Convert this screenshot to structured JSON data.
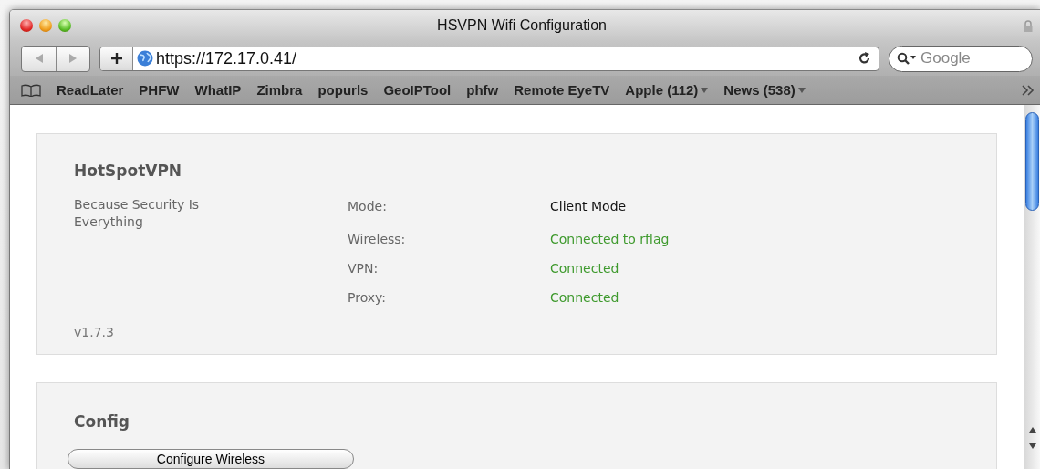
{
  "window": {
    "title": "HSVPN Wifi Configuration"
  },
  "toolbar": {
    "url": "https://172.17.0.41/",
    "search": {
      "placeholder": "Google"
    }
  },
  "bookmarks": [
    {
      "label": "ReadLater",
      "kind": "link"
    },
    {
      "label": "PHFW",
      "kind": "link"
    },
    {
      "label": "WhatIP",
      "kind": "link"
    },
    {
      "label": "Zimbra",
      "kind": "link"
    },
    {
      "label": "popurls",
      "kind": "link"
    },
    {
      "label": "GeoIPTool",
      "kind": "link"
    },
    {
      "label": "phfw",
      "kind": "link"
    },
    {
      "label": "Remote EyeTV",
      "kind": "link"
    },
    {
      "label": "Apple (112)",
      "kind": "menu"
    },
    {
      "label": "News (538)",
      "kind": "menu"
    }
  ],
  "status_panel": {
    "title": "HotSpotVPN",
    "tagline": "Because Security Is Everything",
    "version": "v1.7.3",
    "rows": [
      {
        "label": "Mode:",
        "value": "Client Mode",
        "color": "#111111"
      },
      {
        "label": "Wireless:",
        "value": "Connected to rflag",
        "color": "#3f9a2e"
      },
      {
        "label": "VPN:",
        "value": "Connected",
        "color": "#3f9a2e"
      },
      {
        "label": "Proxy:",
        "value": "Connected",
        "color": "#3f9a2e"
      }
    ]
  },
  "config_panel": {
    "title": "Config",
    "buttons": [
      "Configure Wireless"
    ]
  }
}
